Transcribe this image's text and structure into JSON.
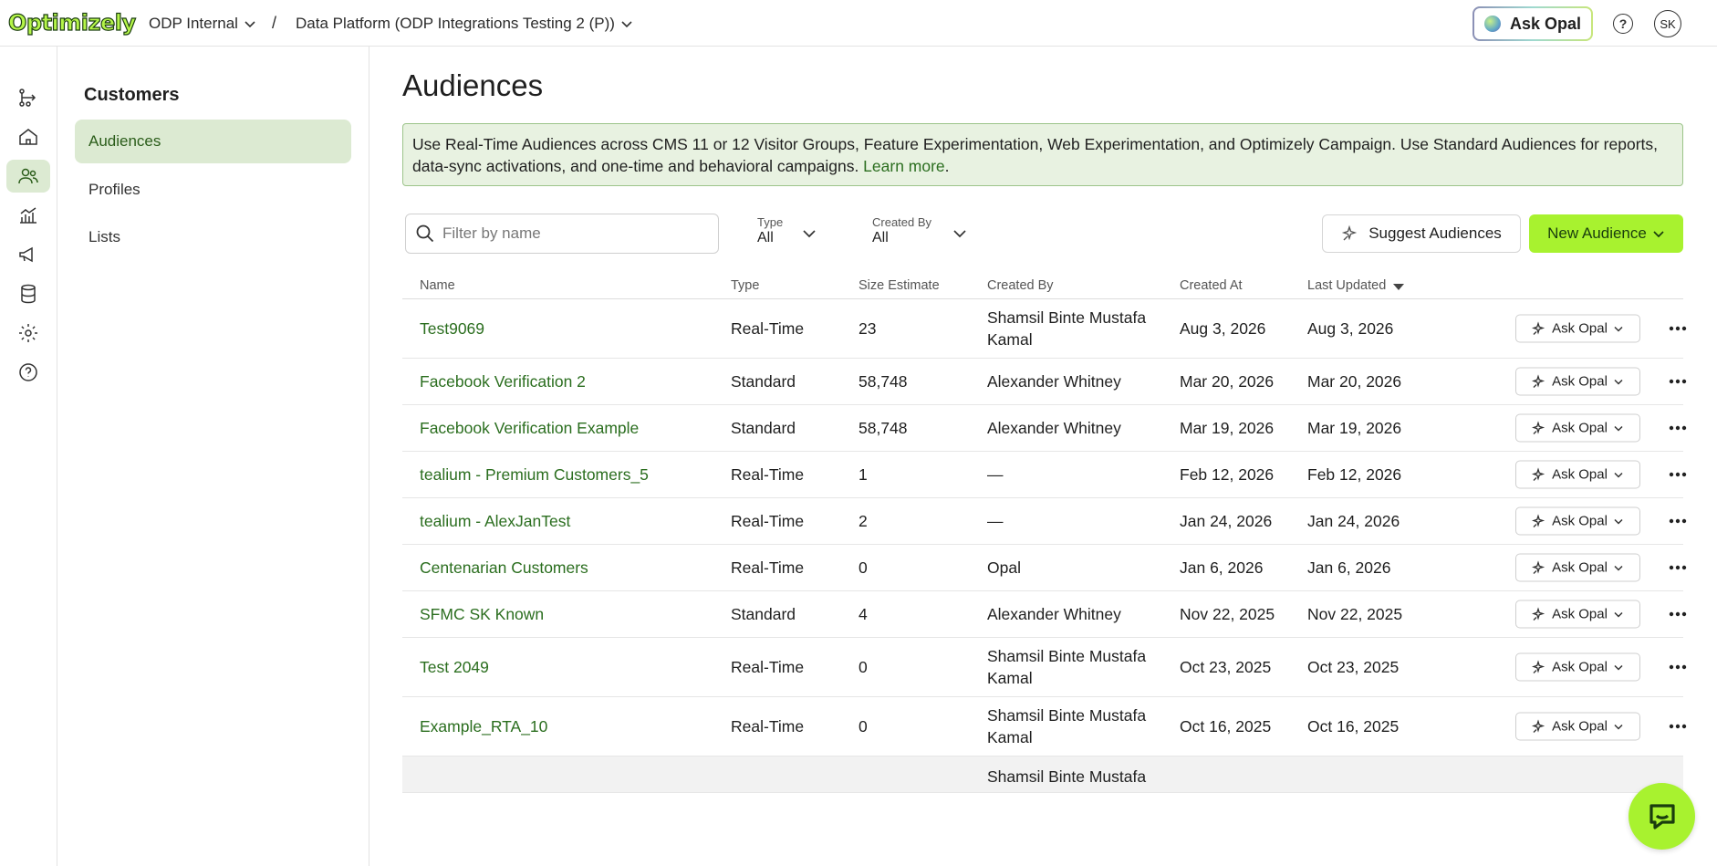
{
  "topbar": {
    "logo": "Optimizely",
    "org": "ODP Internal",
    "separator": "/",
    "project": "Data Platform (ODP Integrations Testing 2 (P))",
    "ask_opal": "Ask Opal",
    "help_glyph": "?",
    "avatar_initials": "SK"
  },
  "rail": {
    "items": [
      {
        "icon": "flow-icon"
      },
      {
        "icon": "home-icon"
      },
      {
        "icon": "customers-icon",
        "active": true
      },
      {
        "icon": "analytics-icon"
      },
      {
        "icon": "campaigns-icon"
      },
      {
        "icon": "database-icon"
      },
      {
        "icon": "settings-icon"
      },
      {
        "icon": "help-icon"
      }
    ]
  },
  "subnav": {
    "title": "Customers",
    "items": [
      {
        "label": "Audiences",
        "active": true
      },
      {
        "label": "Profiles"
      },
      {
        "label": "Lists"
      }
    ]
  },
  "main": {
    "title": "Audiences",
    "banner": {
      "text": "Use Real-Time Audiences across CMS 11 or 12 Visitor Groups, Feature Experimentation, Web Experimentation, and Optimizely Campaign. Use Standard Audiences for reports, data-sync activations, and one-time and behavioral campaigns. ",
      "link": "Learn more",
      "tail": "."
    },
    "filter": {
      "placeholder": "Filter by name",
      "value": ""
    },
    "type_filter": {
      "label": "Type",
      "value": "All"
    },
    "created_by_filter": {
      "label": "Created By",
      "value": "All"
    },
    "suggest_button": "Suggest Audiences",
    "new_button": "New Audience"
  },
  "table": {
    "columns": [
      "Name",
      "Type",
      "Size Estimate",
      "Created By",
      "Created At",
      "Last Updated"
    ],
    "row_action": "Ask Opal",
    "rows": [
      {
        "name": "Test9069",
        "type": "Real-Time",
        "size": "23",
        "created_by": "Shamsil Binte Mustafa Kamal",
        "created_at": "Aug 3, 2026",
        "updated": "Aug 3, 2026"
      },
      {
        "name": "Facebook Verification 2",
        "type": "Standard",
        "size": "58,748",
        "created_by": "Alexander Whitney",
        "created_at": "Mar 20, 2026",
        "updated": "Mar 20, 2026"
      },
      {
        "name": "Facebook Verification Example",
        "type": "Standard",
        "size": "58,748",
        "created_by": "Alexander Whitney",
        "created_at": "Mar 19, 2026",
        "updated": "Mar 19, 2026"
      },
      {
        "name": "tealium - Premium Customers_5",
        "type": "Real-Time",
        "size": "1",
        "created_by": "—",
        "created_at": "Feb 12, 2026",
        "updated": "Feb 12, 2026"
      },
      {
        "name": "tealium - AlexJanTest",
        "type": "Real-Time",
        "size": "2",
        "created_by": "—",
        "created_at": "Jan 24, 2026",
        "updated": "Jan 24, 2026"
      },
      {
        "name": "Centenarian Customers",
        "type": "Real-Time",
        "size": "0",
        "created_by": "Opal",
        "created_at": "Jan 6, 2026",
        "updated": "Jan 6, 2026"
      },
      {
        "name": "SFMC SK Known",
        "type": "Standard",
        "size": "4",
        "created_by": "Alexander Whitney",
        "created_at": "Nov 22, 2025",
        "updated": "Nov 22, 2025"
      },
      {
        "name": "Test 2049",
        "type": "Real-Time",
        "size": "0",
        "created_by": "Shamsil Binte Mustafa Kamal",
        "created_at": "Oct 23, 2025",
        "updated": "Oct 23, 2025"
      },
      {
        "name": "Example_RTA_10",
        "type": "Real-Time",
        "size": "0",
        "created_by": "Shamsil Binte Mustafa Kamal",
        "created_at": "Oct 16, 2025",
        "updated": "Oct 16, 2025"
      },
      {
        "name": "",
        "type": "",
        "size": "",
        "created_by": "Shamsil Binte Mustafa",
        "created_at": "",
        "updated": ""
      }
    ]
  },
  "colors": {
    "accent": "#a8f22f",
    "link": "#2b6e1f",
    "active_bg": "#dcead2",
    "banner_bg": "#e8f2e1"
  }
}
